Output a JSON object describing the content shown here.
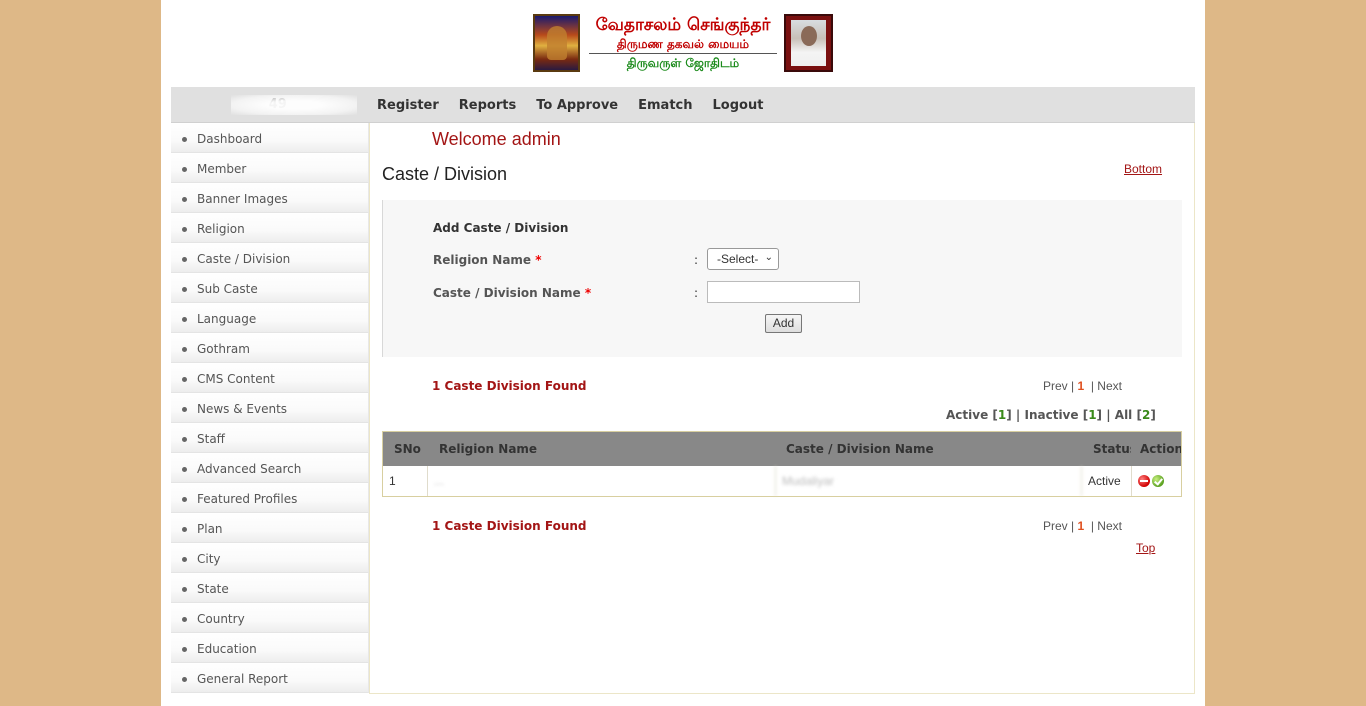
{
  "header": {
    "logo_line1": "வேதாசலம் செங்குந்தர்",
    "logo_line2": "திருமண தகவல் மையம்",
    "logo_line3": "திருவருள் ஜோதிடம்"
  },
  "navbar": {
    "ip_text": "49",
    "items": [
      "Register",
      "Reports",
      "To Approve",
      "Ematch",
      "Logout"
    ]
  },
  "sidebar": {
    "items": [
      "Dashboard",
      "Member",
      "Banner Images",
      "Religion",
      "Caste / Division",
      "Sub Caste",
      "Language",
      "Gothram",
      "CMS Content",
      "News & Events",
      "Staff",
      "Advanced Search",
      "Featured Profiles",
      "Plan",
      "City",
      "State",
      "Country",
      "Education",
      "General Report"
    ]
  },
  "main": {
    "welcome": "Welcome admin",
    "title": "Caste / Division",
    "bottom_link": "Bottom",
    "top_link": "Top"
  },
  "form": {
    "heading": "Add Caste / Division",
    "religion_label": "Religion Name",
    "caste_label": "Caste / Division Name",
    "required_mark": "*",
    "colon": ":",
    "select_value": "-Select-",
    "caste_value": "",
    "add_label": "Add"
  },
  "results": {
    "found_text": "1 Caste Division Found",
    "prev": "Prev",
    "page": "1",
    "next": "Next",
    "filter": {
      "active_label": "Active",
      "active_count": "1",
      "inactive_label": "Inactive",
      "inactive_count": "1",
      "all_label": "All",
      "all_count": "2"
    }
  },
  "table": {
    "headers": [
      "SNo",
      "Religion Name",
      "Caste / Division Name",
      "Status",
      "Action"
    ],
    "rows": [
      {
        "sno": "1",
        "religion": "...",
        "caste": "Mudaliyar",
        "status": "Active"
      }
    ]
  },
  "icons": {
    "delete": "delete-icon",
    "approve": "approve-icon"
  },
  "colors": {
    "background": "#deb887",
    "accent": "#a31515",
    "nav_bg": "#e0e0e0",
    "table_header": "#888888"
  }
}
